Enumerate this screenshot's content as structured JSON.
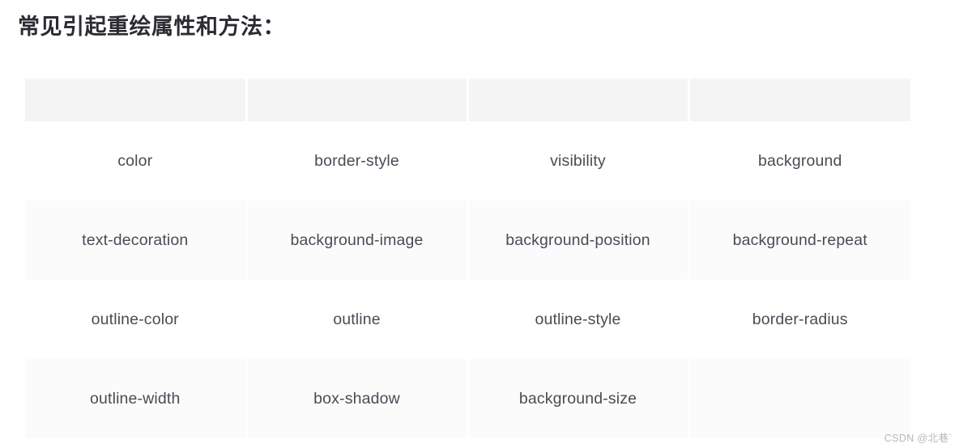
{
  "heading": "常见引起重绘属性和方法：",
  "table": {
    "column_headers": [
      "",
      "",
      "",
      ""
    ],
    "rows": [
      [
        "color",
        "border-style",
        "visibility",
        "background"
      ],
      [
        "text-decoration",
        "background-image",
        "background-position",
        "background-repeat"
      ],
      [
        "outline-color",
        "outline",
        "outline-style",
        "border-radius"
      ],
      [
        "outline-width",
        "box-shadow",
        "background-size",
        ""
      ]
    ]
  },
  "watermark": "CSDN @北巷`",
  "colors": {
    "heading_text": "#2b2b33",
    "cell_text": "#4b4b56",
    "header_band": "#f4f4f5",
    "row_even": "#fbfbfc",
    "row_odd": "#ffffff",
    "watermark_text": "#b9b9bd",
    "page_background": "#ffffff"
  }
}
